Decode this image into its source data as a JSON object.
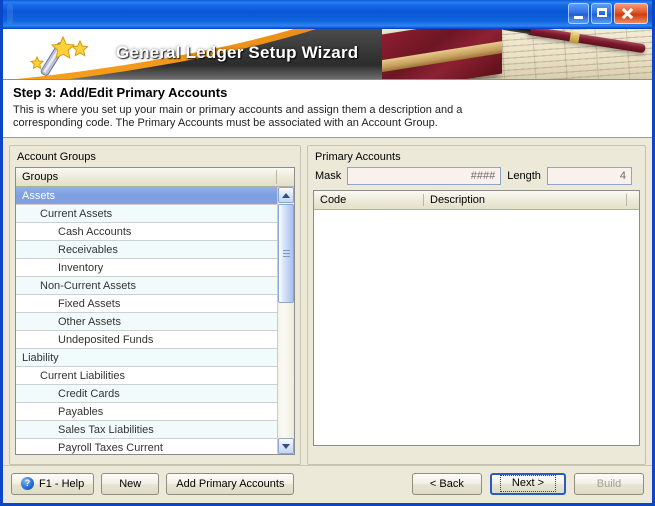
{
  "window": {
    "title": "",
    "controls": {
      "minimize": "minimize-button",
      "maximize": "maximize-button",
      "close": "close-button"
    }
  },
  "banner": {
    "title": "General Ledger Setup Wizard",
    "icon": "magic-wand-icon"
  },
  "header": {
    "step_title": "Step 3: Add/Edit Primary Accounts",
    "description": "This is where you set up your main or primary accounts and assign them a description and a corresponding code. The Primary Accounts must be associated with an Account Group."
  },
  "account_groups": {
    "groupbox_title": "Account Groups",
    "column_header": "Groups",
    "selected_index": 0,
    "rows": [
      {
        "label": "Assets",
        "indent": 0,
        "selected": true
      },
      {
        "label": "Current Assets",
        "indent": 1,
        "selected": false
      },
      {
        "label": "Cash Accounts",
        "indent": 2,
        "selected": false
      },
      {
        "label": "Receivables",
        "indent": 2,
        "selected": false
      },
      {
        "label": "Inventory",
        "indent": 2,
        "selected": false
      },
      {
        "label": "Non-Current Assets",
        "indent": 1,
        "selected": false
      },
      {
        "label": "Fixed Assets",
        "indent": 2,
        "selected": false
      },
      {
        "label": "Other Assets",
        "indent": 2,
        "selected": false
      },
      {
        "label": "Undeposited Funds",
        "indent": 2,
        "selected": false
      },
      {
        "label": "Liability",
        "indent": 0,
        "selected": false
      },
      {
        "label": "Current Liabilities",
        "indent": 1,
        "selected": false
      },
      {
        "label": "Credit Cards",
        "indent": 2,
        "selected": false
      },
      {
        "label": "Payables",
        "indent": 2,
        "selected": false
      },
      {
        "label": "Sales Tax Liabilities",
        "indent": 2,
        "selected": false
      },
      {
        "label": "Payroll Taxes Current",
        "indent": 2,
        "selected": false
      }
    ]
  },
  "primary_accounts": {
    "groupbox_title": "Primary Accounts",
    "mask_label": "Mask",
    "mask_value": "####",
    "length_label": "Length",
    "length_value": "4",
    "columns": [
      "Code",
      "Description"
    ],
    "rows": []
  },
  "footer": {
    "help_label": "F1 - Help",
    "help_icon": "question-mark-icon",
    "new_label": "New",
    "add_primary_label": "Add Primary Accounts",
    "back_label": "< Back",
    "next_label": "Next >",
    "build_label": "Build",
    "build_disabled": true
  },
  "colors": {
    "titlebar_blue": "#0a57d6",
    "window_border": "#0b46c8",
    "dialog_face": "#ece9d8",
    "selection_blue": "#7e9fe0",
    "banner_orange": "#f0941a",
    "field_bg": "#faf0ec",
    "close_red": "#cc3d12"
  }
}
